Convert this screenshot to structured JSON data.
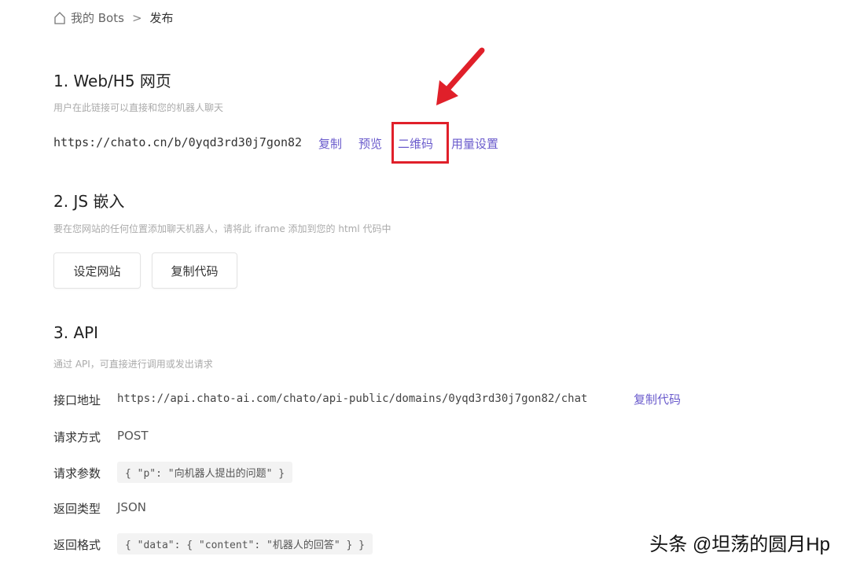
{
  "breadcrumb": {
    "home_icon": "home-icon",
    "parent": "我的 Bots",
    "separator": ">",
    "current": "发布"
  },
  "web": {
    "title": "1. Web/H5 网页",
    "description": "用户在此链接可以直接和您的机器人聊天",
    "url": "https://chato.cn/b/0yqd3rd30j7gon82",
    "actions": {
      "copy": "复制",
      "preview": "预览",
      "qrcode": "二维码",
      "usage": "用量设置"
    }
  },
  "js": {
    "title": "2. JS 嵌入",
    "description": "要在您网站的任何位置添加聊天机器人，请将此 iframe 添加到您的 html 代码中",
    "buttons": {
      "set_site": "设定网站",
      "copy_code": "复制代码"
    }
  },
  "api": {
    "title": "3. API",
    "description": "通过 API，可直接进行调用或发出请求",
    "endpoint_label": "接口地址",
    "endpoint_value": "https://api.chato-ai.com/chato/api-public/domains/0yqd3rd30j7gon82/chat",
    "copy_code": "复制代码",
    "method_label": "请求方式",
    "method_value": "POST",
    "params_label": "请求参数",
    "params_value": "{ \"p\": \"向机器人提出的问题\" }",
    "return_type_label": "返回类型",
    "return_type_value": "JSON",
    "return_format_label": "返回格式",
    "return_format_value": "{ \"data\": { \"content\": \"机器人的回答\" } }"
  },
  "annotation": {
    "color": "#e0202a",
    "arrow_icon": "red-arrow-icon"
  },
  "watermark": "头条 @坦荡的圆月Hp",
  "colors": {
    "link": "#6a5bcc",
    "highlight": "#e0202a"
  }
}
